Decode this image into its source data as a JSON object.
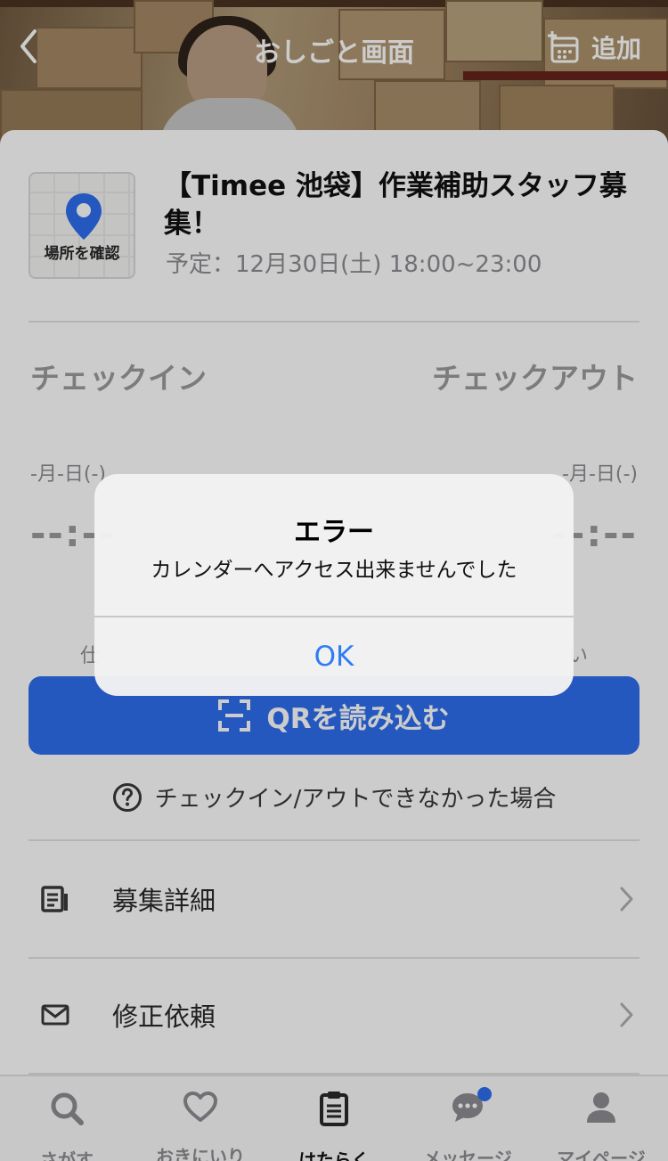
{
  "header": {
    "title": "おしごと画面",
    "add_label": "追加"
  },
  "job": {
    "map_label": "場所を確認",
    "title": "【Timee 池袋】作業補助スタッフ募集！",
    "schedule": "予定：12月30日(土) 18:00~23:00"
  },
  "checkin": {
    "label": "チェックイン",
    "date": "-月-日(-)",
    "time": "--:--",
    "note": "仕"
  },
  "checkout": {
    "label": "チェックアウト",
    "date": "-月-日(-)",
    "time": "--:--",
    "note": "い"
  },
  "qr_button_label": "QRを読み込む",
  "help_label": "チェックイン/アウトできなかった場合",
  "menu": [
    {
      "label": "募集詳細",
      "icon": "document-icon"
    },
    {
      "label": "修正依頼",
      "icon": "mail-icon"
    }
  ],
  "tabs": [
    {
      "label": "さがす",
      "icon": "search-icon"
    },
    {
      "label": "おきにいり",
      "icon": "heart-icon"
    },
    {
      "label": "はたらく",
      "icon": "clipboard-icon"
    },
    {
      "label": "メッセージ",
      "icon": "chat-icon"
    },
    {
      "label": "マイページ",
      "icon": "person-icon"
    }
  ],
  "active_tab": "はたらく",
  "alert": {
    "title": "エラー",
    "message": "カレンダーへアクセス出来ませんでした",
    "ok_label": "OK"
  },
  "colors": {
    "accent": "#2f6fef",
    "alert_button": "#2f7cf6",
    "badge": "#2f6fef"
  }
}
